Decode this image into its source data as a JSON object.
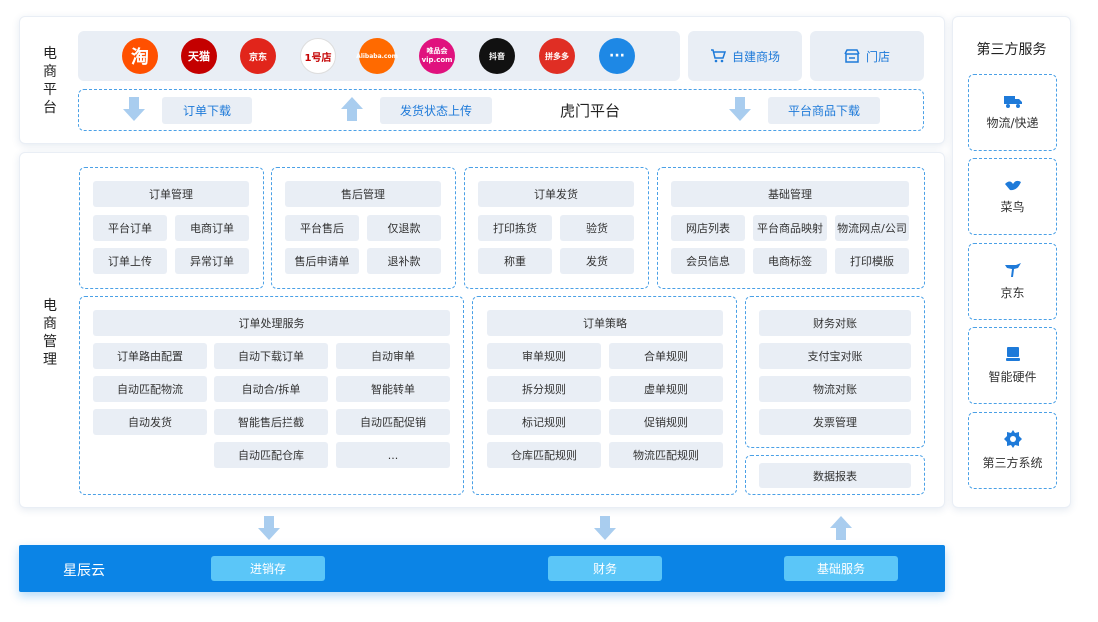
{
  "ec_platform": {
    "title": "电商平台",
    "logos": [
      {
        "icon": "taobao-icon",
        "text": "淘",
        "color": "#ff5000"
      },
      {
        "icon": "tmall-icon",
        "text": "天猫",
        "color": "#c40000"
      },
      {
        "icon": "jd-icon",
        "text": "京东",
        "color": "#e1251b"
      },
      {
        "icon": "yihaodian-icon",
        "text": "1号店",
        "color": "#ffffff"
      },
      {
        "icon": "alibaba-icon",
        "text": "Alibaba.com",
        "color": "#ff6a00"
      },
      {
        "icon": "vip-icon",
        "text": "唯品会 vip.com",
        "color": "#e0127e"
      },
      {
        "icon": "douyin-icon",
        "text": "抖音",
        "color": "#111111"
      },
      {
        "icon": "pinduoduo-icon",
        "text": "拼多多",
        "color": "#e02e24"
      },
      {
        "icon": "more-icon",
        "text": "···",
        "color": "#1e88e5"
      }
    ],
    "self_store": "自建商场",
    "store": "门店",
    "flow": {
      "order_download": "订单下载",
      "ship_upload": "发货状态上传",
      "center": "虎门平台",
      "product_download": "平台商品下载"
    }
  },
  "ec_management": {
    "title": "电商管理",
    "order_mgmt": {
      "title": "订单管理",
      "items": [
        "平台订单",
        "电商订单",
        "订单上传",
        "异常订单"
      ]
    },
    "after_sales": {
      "title": "售后管理",
      "items": [
        "平台售后",
        "仅退款",
        "售后申请单",
        "退补款"
      ]
    },
    "order_ship": {
      "title": "订单发货",
      "items": [
        "打印拣货",
        "验货",
        "称重",
        "发货"
      ]
    },
    "basic_mgmt": {
      "title": "基础管理",
      "items": [
        "网店列表",
        "平台商品映射",
        "物流网点/公司",
        "会员信息",
        "电商标签",
        "打印模版"
      ]
    },
    "order_service": {
      "title": "订单处理服务",
      "items": [
        "订单路由配置",
        "自动下载订单",
        "自动审单",
        "自动匹配物流",
        "自动合/拆单",
        "智能转单",
        "自动发货",
        "智能售后拦截",
        "自动匹配促销",
        "自动匹配仓库",
        "..."
      ]
    },
    "order_strategy": {
      "title": "订单策略",
      "items": [
        "审单规则",
        "合单规则",
        "拆分规则",
        "虚单规则",
        "标记规则",
        "促销规则",
        "仓库匹配规则",
        "物流匹配规则"
      ]
    },
    "finance": {
      "items": [
        "财务对账",
        "支付宝对账",
        "物流对账",
        "发票管理"
      ]
    },
    "report": "数据报表"
  },
  "third_party": {
    "title": "第三方服务",
    "items": [
      {
        "icon": "truck-icon",
        "label": "物流/快递"
      },
      {
        "icon": "cainiao-icon",
        "label": "菜鸟"
      },
      {
        "icon": "jd-dog-icon",
        "label": "京东"
      },
      {
        "icon": "hardware-icon",
        "label": "智能硬件"
      },
      {
        "icon": "gear-icon",
        "label": "第三方系统"
      }
    ]
  },
  "cloud": {
    "title": "星辰云",
    "buttons": [
      "进销存",
      "财务",
      "基础服务"
    ]
  },
  "colors": {
    "accent": "#1e7ad9",
    "dashed_border": "#4aa0e6",
    "chip_bg": "#e9eef5",
    "cloud_bar": "#0b84e6",
    "cloud_button": "#5bc6f8",
    "arrow": "#a9cdef"
  }
}
